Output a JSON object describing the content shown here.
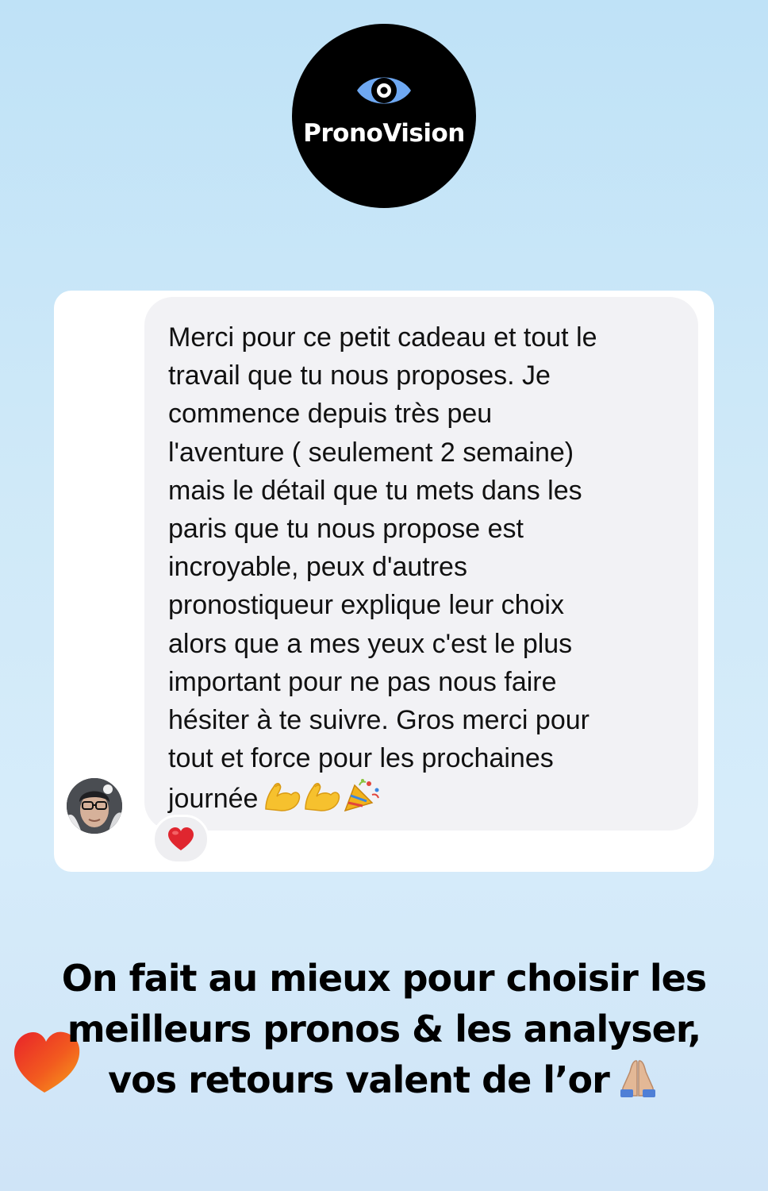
{
  "brand": {
    "name": "PronoVision",
    "logo_icon": "eye-icon"
  },
  "message": {
    "lines": [
      "Merci pour ce petit cadeau et tout le",
      "travail que tu nous proposes. Je",
      "commence depuis très peu",
      "l'aventure ( seulement 2 semaine)",
      "mais le détail que tu mets dans les",
      "paris que tu nous propose est",
      "incroyable, peux d'autres",
      "pronostiqueur explique leur choix",
      "alors que a mes yeux c'est le plus",
      "important pour ne pas nous faire",
      "hésiter à te suivre. Gros merci pour",
      "tout et force pour les prochaines",
      "journée"
    ],
    "trailing_emojis": [
      "flexed-biceps-icon",
      "flexed-biceps-icon",
      "party-popper-icon"
    ],
    "reaction": "red-heart-icon"
  },
  "caption": {
    "lines": [
      "On fait au mieux pour choisir les",
      "meilleurs pronos & les analyser,",
      "vos retours valent de l’or"
    ],
    "trailing_emoji": "folded-hands-icon",
    "sticker": "gradient-heart-icon"
  },
  "colors": {
    "background": "#cfe9f8",
    "card": "#ffffff",
    "bubble": "#f2f2f5",
    "logo_bg": "#000000",
    "eye_blue": "#6ea8f2",
    "heart_red": "#e0262f"
  }
}
